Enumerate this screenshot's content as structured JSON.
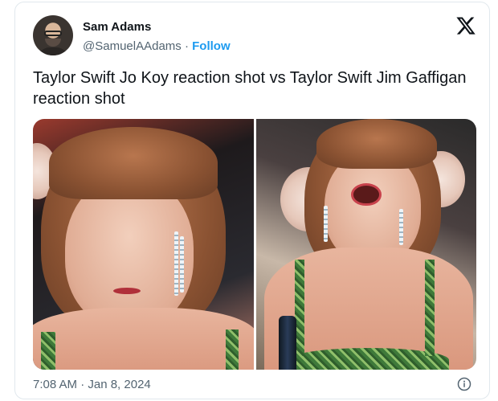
{
  "author": {
    "name": "Sam Adams",
    "handle": "@SamuelAAdams",
    "separator": "·",
    "follow_label": "Follow"
  },
  "tweet": {
    "text": "Taylor Swift Jo Koy reaction shot vs Taylor Swift Jim Gaffigan reaction shot",
    "media_count": 2
  },
  "footer": {
    "timestamp": "7:08 AM · Jan 8, 2024"
  },
  "icons": {
    "brand": "x-logo-icon",
    "info": "info-icon"
  },
  "colors": {
    "text": "#0f1419",
    "secondary": "#536471",
    "accent": "#1d9bf0",
    "border": "#e1e8ed"
  }
}
